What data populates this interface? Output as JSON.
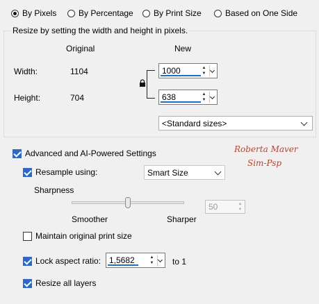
{
  "modes": [
    {
      "label": "By Pixels",
      "selected": true
    },
    {
      "label": "By Percentage",
      "selected": false
    },
    {
      "label": "By Print Size",
      "selected": false
    },
    {
      "label": "Based on One Side",
      "selected": false
    }
  ],
  "resize_group": {
    "title": "Resize by setting the width and height in pixels.",
    "original_header": "Original",
    "new_header": "New",
    "width_label": "Width:",
    "width_original": "1104",
    "width_new": "1000",
    "height_label": "Height:",
    "height_original": "704",
    "height_new": "638",
    "standard_sizes": "<Standard sizes>"
  },
  "advanced": {
    "label": "Advanced and AI-Powered Settings",
    "checked": true,
    "resample_label": "Resample using:",
    "resample_checked": true,
    "resample_value": "Smart Size",
    "sharpness_label": "Sharpness",
    "smoother_label": "Smoother",
    "sharper_label": "Sharper",
    "sharpness_value": "50",
    "sharpness_fraction": 0.5,
    "maintain_label": "Maintain original print size",
    "maintain_checked": false,
    "lock_label": "Lock aspect ratio:",
    "lock_checked": true,
    "ratio_value": "1,5682",
    "ratio_suffix": "to 1",
    "resize_layers_label": "Resize all layers",
    "resize_layers_checked": true
  },
  "watermark": {
    "line1": "Roberta Maver",
    "line2": "Sim-Psp"
  },
  "colors": {
    "accent": "#1f6fc5",
    "check": "#2f67c6",
    "watermark": "#b8432b"
  }
}
